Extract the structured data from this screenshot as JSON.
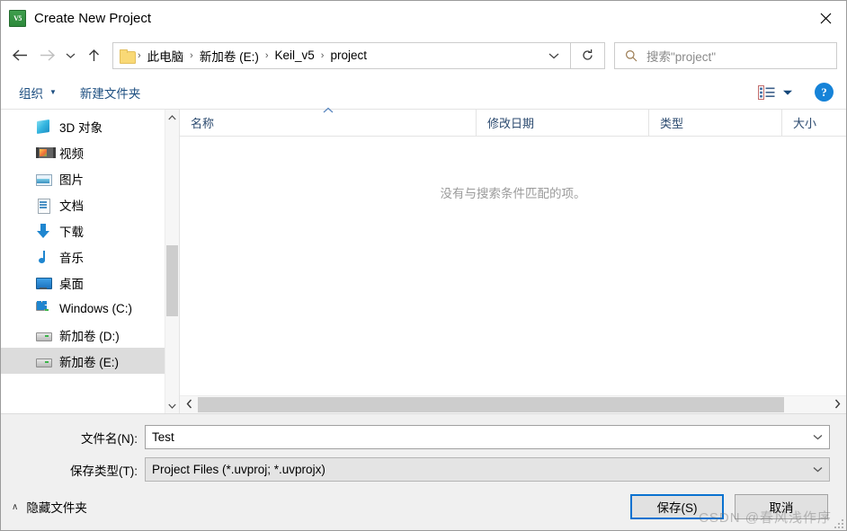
{
  "window": {
    "title": "Create New Project",
    "app_icon": "keil-uvision-icon",
    "icon_text": "V5",
    "close_label": "✕"
  },
  "nav": {
    "back_icon": "back-arrow-icon",
    "forward_icon": "forward-arrow-icon",
    "recent_icon": "recent-locations-chevron-icon",
    "up_icon": "up-arrow-icon",
    "refresh_icon": "refresh-icon",
    "breadcrumbs": [
      "此电脑",
      "新加卷 (E:)",
      "Keil_v5",
      "project"
    ],
    "separator": "›",
    "dropdown_icon": "chevron-down-icon"
  },
  "search": {
    "placeholder": "搜索\"project\"",
    "icon": "search-icon"
  },
  "toolbar": {
    "organize_label": "组织",
    "organize_caret": "▼",
    "new_folder_label": "新建文件夹",
    "view_icon": "view-options-icon",
    "view_caret": "▼",
    "help_label": "?"
  },
  "sidebar": {
    "items": [
      {
        "label": "3D 对象",
        "icon": "cube-icon",
        "selected": false
      },
      {
        "label": "视频",
        "icon": "video-icon",
        "selected": false
      },
      {
        "label": "图片",
        "icon": "picture-icon",
        "selected": false
      },
      {
        "label": "文档",
        "icon": "document-icon",
        "selected": false
      },
      {
        "label": "下载",
        "icon": "download-icon",
        "selected": false
      },
      {
        "label": "音乐",
        "icon": "music-icon",
        "selected": false
      },
      {
        "label": "桌面",
        "icon": "desktop-icon",
        "selected": false
      },
      {
        "label": "Windows (C:)",
        "icon": "windows-drive-icon",
        "selected": false
      },
      {
        "label": "新加卷 (D:)",
        "icon": "drive-icon",
        "selected": false
      },
      {
        "label": "新加卷 (E:)",
        "icon": "drive-icon",
        "selected": true
      }
    ],
    "scroll_up_icon": "chevron-up-icon",
    "scroll_down_icon": "chevron-down-icon"
  },
  "filelist": {
    "columns": [
      {
        "label": "名称",
        "sorted": true,
        "sort_caret": "︿"
      },
      {
        "label": "修改日期",
        "sorted": false
      },
      {
        "label": "类型",
        "sorted": false
      },
      {
        "label": "大小",
        "sorted": false
      }
    ],
    "empty_message": "没有与搜索条件匹配的项。",
    "rows": [],
    "hscroll_left_icon": "scroll-left-icon",
    "hscroll_right_icon": "scroll-right-icon"
  },
  "form": {
    "filename_label": "文件名(N):",
    "filename_value": "Test",
    "filetype_label": "保存类型(T):",
    "filetype_value": "Project Files (*.uvproj; *.uvprojx)",
    "combo_arrow": "chevron-down-icon"
  },
  "footer": {
    "hide_folders_label": "隐藏文件夹",
    "hide_folders_caret": "∧",
    "save_label": "保存(S)",
    "cancel_label": "取消"
  },
  "watermark": {
    "text": "CSDN @春风浅作序"
  },
  "colors": {
    "accent_blue": "#0a72d0",
    "link_blue": "#1c4e80",
    "selection_gray": "#dcdcdc",
    "footer_bg": "#f0f0f0",
    "help_blue": "#1683d8"
  }
}
